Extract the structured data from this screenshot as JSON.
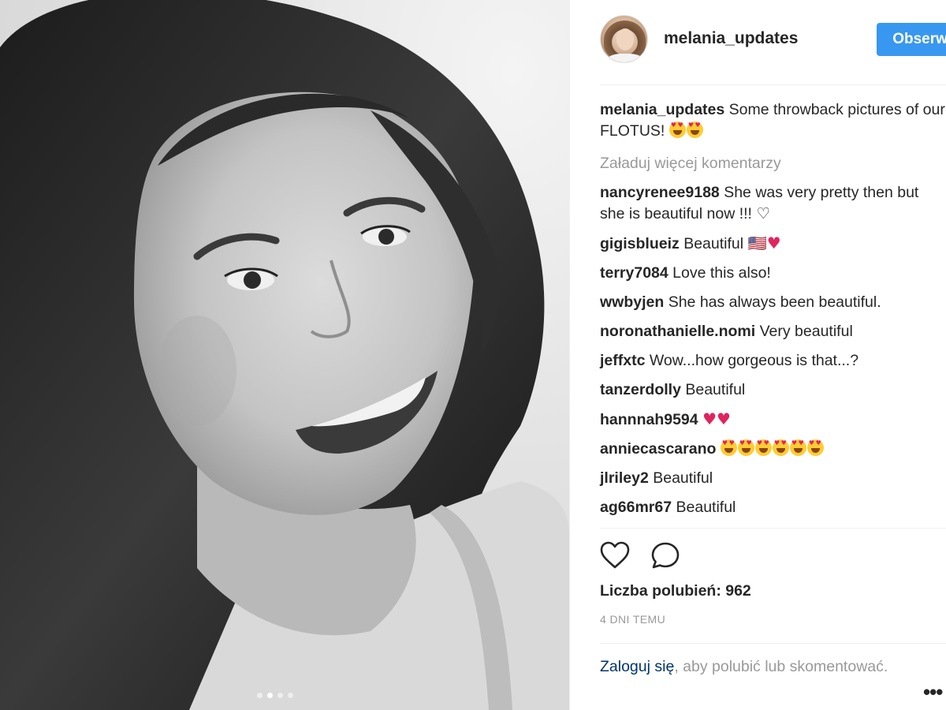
{
  "post": {
    "carousel": {
      "count": 4,
      "active_index": 1
    }
  },
  "header": {
    "username": "melania_updates",
    "follow_label": "Obserwuj"
  },
  "caption": {
    "username": "melania_updates",
    "text": "Some throwback pictures of our FLOTUS!"
  },
  "load_more_label": "Załaduj więcej komentarzy",
  "comments": [
    {
      "user": "nancyrenee9188",
      "text": "She was very pretty then but she is beautiful now !!! ♡"
    },
    {
      "user": "gigisblueiz",
      "text": "Beautiful 🇺🇸"
    },
    {
      "user": "terry7084",
      "text": "Love this also!"
    },
    {
      "user": "wwbyjen",
      "text": "She has always been beautiful."
    },
    {
      "user": "noronathanielle.nomi",
      "text": "Very beautiful"
    },
    {
      "user": "jeffxtc",
      "text": "Wow...how gorgeous is that...?"
    },
    {
      "user": "tanzerdolly",
      "text": "Beautiful"
    },
    {
      "user": "hannnah9594",
      "text": ""
    },
    {
      "user": "anniecascarano",
      "text": ""
    },
    {
      "user": "jlriley2",
      "text": "Beautiful"
    },
    {
      "user": "ag66mr67",
      "text": "Beautiful"
    }
  ],
  "actions": {
    "like_icon": "heart-icon",
    "comment_icon": "comment-bubble-icon"
  },
  "likes_text": "Liczba polubień: 962",
  "time_text": "4 DNI TEMU",
  "login": {
    "link": "Zaloguj się",
    "rest": ", aby polubić lub skomentować."
  },
  "more_icon": "ellipsis-icon",
  "colors": {
    "accent": "#3897f0",
    "text": "#262626",
    "muted": "#999999",
    "link": "#003569"
  }
}
